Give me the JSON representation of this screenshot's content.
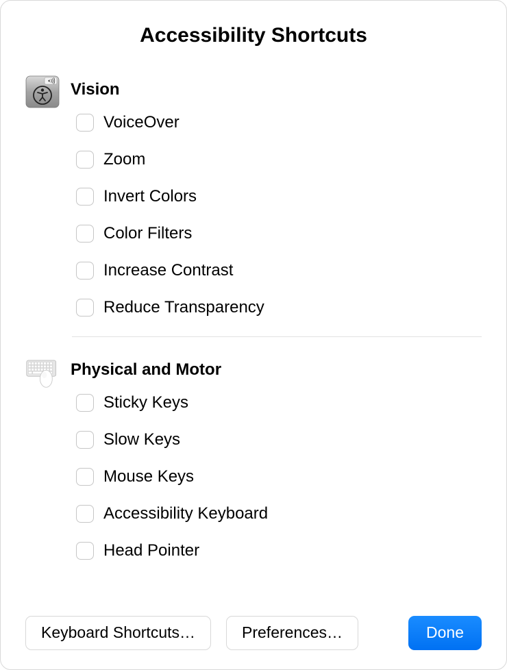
{
  "title": "Accessibility Shortcuts",
  "sections": {
    "vision": {
      "title": "Vision",
      "options": [
        {
          "label": "VoiceOver",
          "checked": false
        },
        {
          "label": "Zoom",
          "checked": false
        },
        {
          "label": "Invert Colors",
          "checked": false
        },
        {
          "label": "Color Filters",
          "checked": false
        },
        {
          "label": "Increase Contrast",
          "checked": false
        },
        {
          "label": "Reduce Transparency",
          "checked": false
        }
      ]
    },
    "physical": {
      "title": "Physical and Motor",
      "options": [
        {
          "label": "Sticky Keys",
          "checked": false
        },
        {
          "label": "Slow Keys",
          "checked": false
        },
        {
          "label": "Mouse Keys",
          "checked": false
        },
        {
          "label": "Accessibility Keyboard",
          "checked": false
        },
        {
          "label": "Head Pointer",
          "checked": false
        }
      ]
    }
  },
  "buttons": {
    "keyboard_shortcuts": "Keyboard Shortcuts…",
    "preferences": "Preferences…",
    "done": "Done"
  },
  "colors": {
    "primary": "#007aff",
    "border": "#d8d8d8",
    "text": "#000000"
  }
}
